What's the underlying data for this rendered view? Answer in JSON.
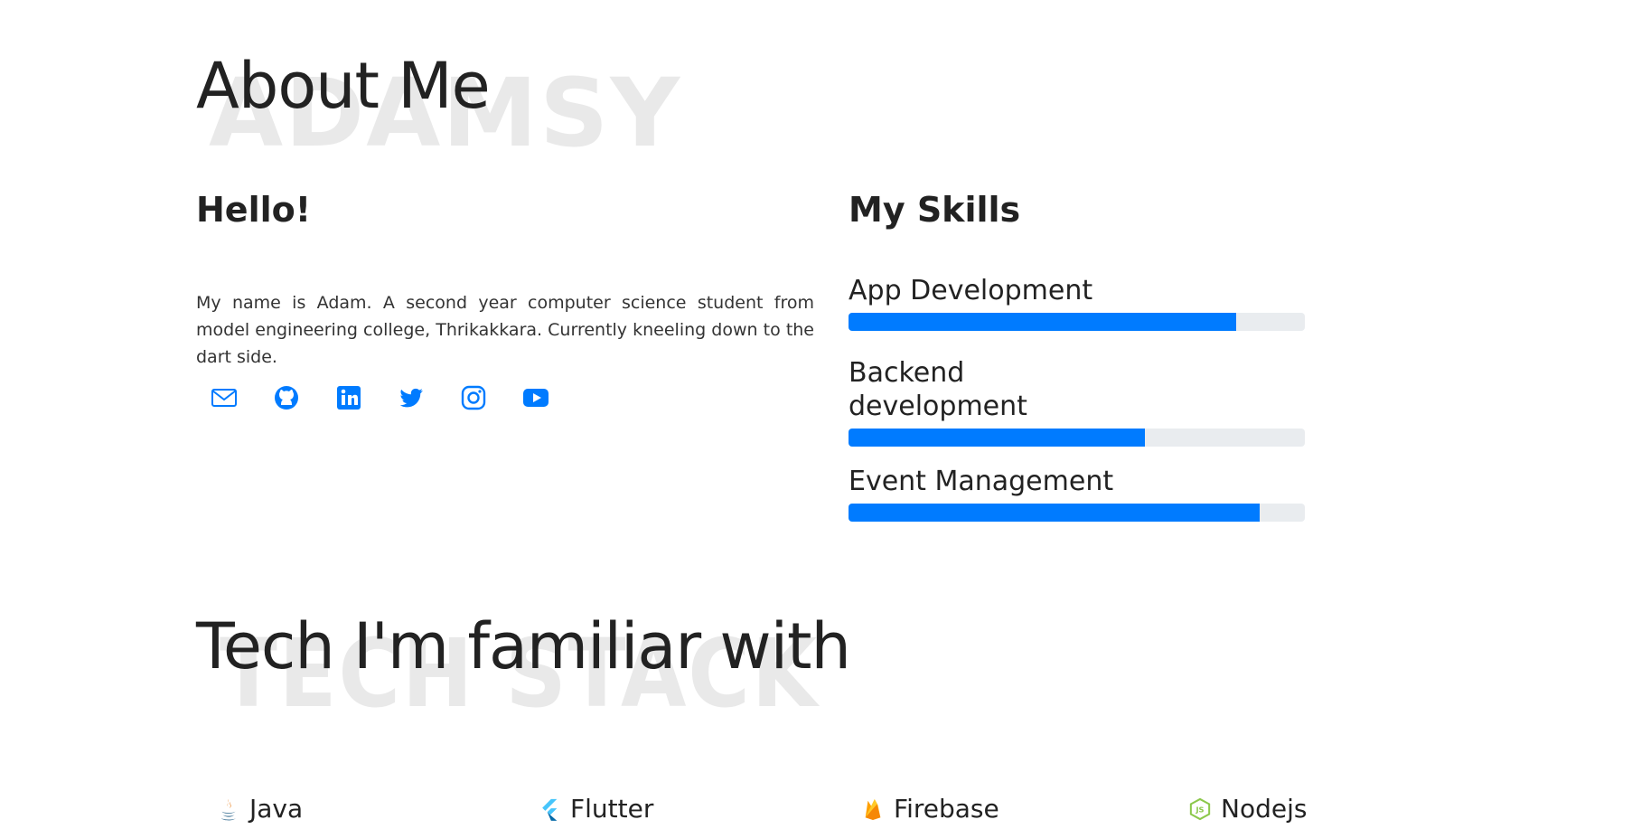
{
  "about": {
    "watermark": "ADAMSY",
    "title": "About Me",
    "greeting": "Hello!",
    "bio": "My name is Adam. A second year computer science student from model engineering college, Thrikakkara. Currently kneeling down to the dart side."
  },
  "socials": [
    {
      "name": "mail-icon"
    },
    {
      "name": "github-icon"
    },
    {
      "name": "linkedin-icon"
    },
    {
      "name": "twitter-icon"
    },
    {
      "name": "instagram-icon"
    },
    {
      "name": "youtube-icon"
    }
  ],
  "skills": {
    "heading": "My Skills",
    "items": [
      {
        "label": "App Development",
        "percent": 85
      },
      {
        "label": "Backend development",
        "percent": 65
      },
      {
        "label": "Event Management",
        "percent": 90
      }
    ]
  },
  "tech": {
    "watermark": "TECH STACK",
    "title": "Tech I'm familiar with",
    "items": [
      {
        "label": "Java",
        "icon": "java-icon"
      },
      {
        "label": "Flutter",
        "icon": "flutter-icon"
      },
      {
        "label": "Firebase",
        "icon": "firebase-icon"
      },
      {
        "label": "Nodejs",
        "icon": "nodejs-icon"
      }
    ]
  },
  "colors": {
    "accent": "#007bff",
    "track": "#e9ecef",
    "watermark": "#e9e9e9"
  }
}
